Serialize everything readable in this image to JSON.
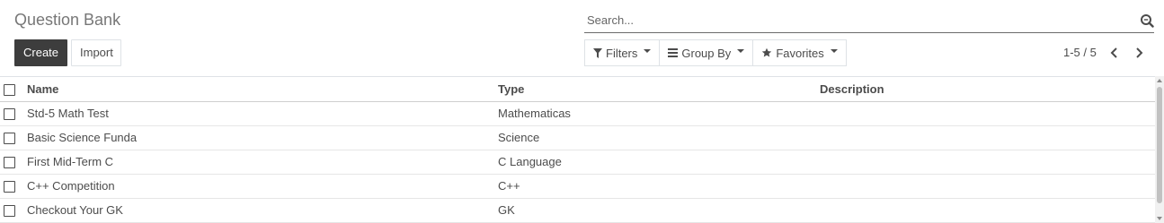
{
  "page": {
    "title": "Question Bank"
  },
  "actions": {
    "create_label": "Create",
    "import_label": "Import"
  },
  "search": {
    "placeholder": "Search...",
    "icon": "search-icon"
  },
  "filters": {
    "filters_label": "Filters",
    "group_by_label": "Group By",
    "favorites_label": "Favorites"
  },
  "pager": {
    "range": "1-5 / 5"
  },
  "table": {
    "columns": [
      "Name",
      "Type",
      "Description"
    ],
    "rows": [
      {
        "name": "Std-5 Math Test",
        "type": "Mathematicas",
        "description": ""
      },
      {
        "name": "Basic Science Funda",
        "type": "Science",
        "description": ""
      },
      {
        "name": "First Mid-Term C",
        "type": "C Language",
        "description": ""
      },
      {
        "name": "C++ Competition",
        "type": "C++",
        "description": ""
      },
      {
        "name": "Checkout Your GK",
        "type": "GK",
        "description": ""
      }
    ]
  },
  "colors": {
    "primary_button": "#3d3d3d",
    "text": "#4c4c4c",
    "border": "#dee2e6"
  }
}
